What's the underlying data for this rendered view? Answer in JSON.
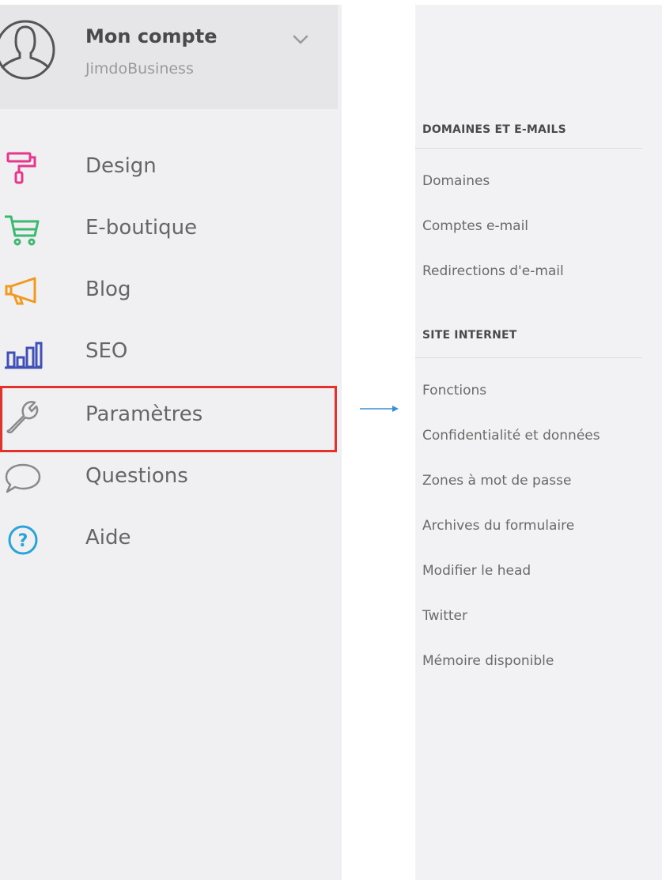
{
  "account": {
    "title": "Mon compte",
    "subtitle": "JimdoBusiness"
  },
  "nav": [
    {
      "label": "Design",
      "icon": "paint-roller-icon",
      "color": "#e5388c"
    },
    {
      "label": "E-boutique",
      "icon": "shopping-cart-icon",
      "color": "#3cb970"
    },
    {
      "label": "Blog",
      "icon": "megaphone-icon",
      "color": "#f29a1f"
    },
    {
      "label": "SEO",
      "icon": "bar-chart-icon",
      "color": "#3f51b5"
    },
    {
      "label": "Paramètres",
      "icon": "wrench-icon",
      "color": "#8a8a8a"
    },
    {
      "label": "Questions",
      "icon": "speech-bubble-icon",
      "color": "#8a8a8a"
    },
    {
      "label": "Aide",
      "icon": "help-circle-icon",
      "color": "#2aa4d8"
    }
  ],
  "highlight_color": "#e4322b",
  "arrow_color": "#3a8fd6",
  "panel": {
    "sections": [
      {
        "heading": "DOMAINES ET E-MAILS",
        "links": [
          "Domaines",
          "Comptes e-mail",
          "Redirections d'e-mail"
        ]
      },
      {
        "heading": "SITE INTERNET",
        "links": [
          "Fonctions",
          "Confidentialité et données",
          "Zones à mot de passe",
          "Archives du formulaire",
          "Modifier le head",
          "Twitter",
          "Mémoire disponible"
        ]
      }
    ]
  }
}
